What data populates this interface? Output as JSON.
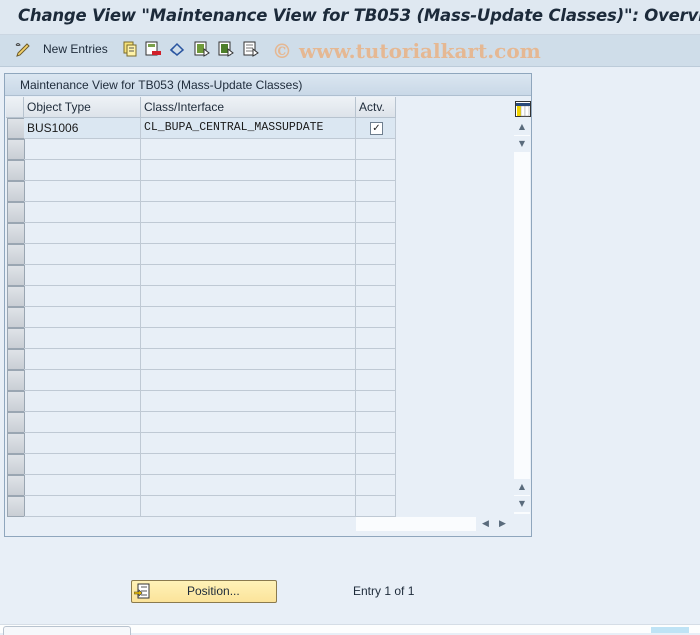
{
  "window": {
    "title": "Change View \"Maintenance View for TB053 (Mass-Update Classes)\": Overvi"
  },
  "toolbar": {
    "items": [
      {
        "name": "display-change-icon",
        "label": ""
      },
      {
        "name": "new-entries",
        "label": "New Entries"
      },
      {
        "name": "copy-icon",
        "label": ""
      },
      {
        "name": "delete-icon",
        "label": ""
      },
      {
        "name": "undo-change-icon",
        "label": ""
      },
      {
        "name": "select-all-icon",
        "label": ""
      },
      {
        "name": "select-block-icon",
        "label": ""
      },
      {
        "name": "deselect-all-icon",
        "label": ""
      }
    ],
    "watermark": "© www.tutorialkart.com"
  },
  "table": {
    "title": "Maintenance View for TB053 (Mass-Update Classes)",
    "columns": [
      "Object Type",
      "Class/Interface",
      "Actv."
    ],
    "rows": [
      {
        "object_type": "BUS1006",
        "class_interface": "CL_BUPA_CENTRAL_MASSUPDATE",
        "active": true
      }
    ],
    "empty_rows": 18
  },
  "footer": {
    "position_button": "Position...",
    "entry_text": "Entry 1 of 1"
  },
  "colors": {
    "accent_button": "#fbe39a",
    "background": "#e8eff7",
    "toolbar": "#cfdde9",
    "watermark": "#e8b48a"
  }
}
